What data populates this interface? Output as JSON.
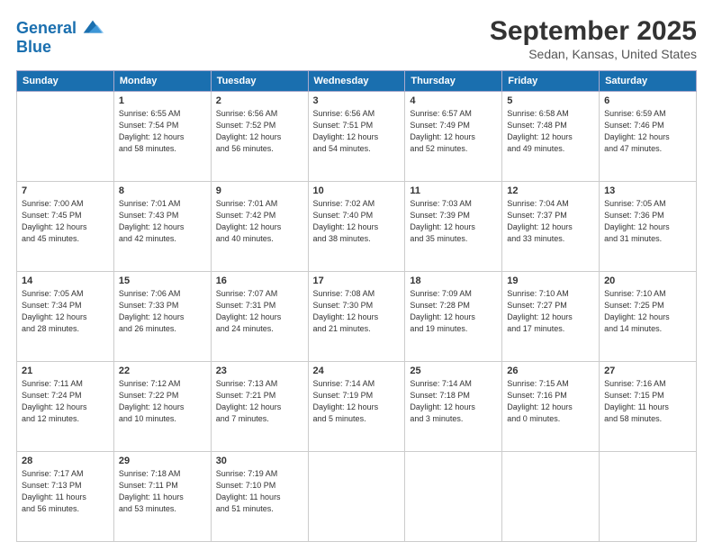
{
  "header": {
    "logo_line1": "General",
    "logo_line2": "Blue",
    "month_title": "September 2025",
    "location": "Sedan, Kansas, United States"
  },
  "weekdays": [
    "Sunday",
    "Monday",
    "Tuesday",
    "Wednesday",
    "Thursday",
    "Friday",
    "Saturday"
  ],
  "weeks": [
    [
      {
        "day": "",
        "info": ""
      },
      {
        "day": "1",
        "info": "Sunrise: 6:55 AM\nSunset: 7:54 PM\nDaylight: 12 hours\nand 58 minutes."
      },
      {
        "day": "2",
        "info": "Sunrise: 6:56 AM\nSunset: 7:52 PM\nDaylight: 12 hours\nand 56 minutes."
      },
      {
        "day": "3",
        "info": "Sunrise: 6:56 AM\nSunset: 7:51 PM\nDaylight: 12 hours\nand 54 minutes."
      },
      {
        "day": "4",
        "info": "Sunrise: 6:57 AM\nSunset: 7:49 PM\nDaylight: 12 hours\nand 52 minutes."
      },
      {
        "day": "5",
        "info": "Sunrise: 6:58 AM\nSunset: 7:48 PM\nDaylight: 12 hours\nand 49 minutes."
      },
      {
        "day": "6",
        "info": "Sunrise: 6:59 AM\nSunset: 7:46 PM\nDaylight: 12 hours\nand 47 minutes."
      }
    ],
    [
      {
        "day": "7",
        "info": "Sunrise: 7:00 AM\nSunset: 7:45 PM\nDaylight: 12 hours\nand 45 minutes."
      },
      {
        "day": "8",
        "info": "Sunrise: 7:01 AM\nSunset: 7:43 PM\nDaylight: 12 hours\nand 42 minutes."
      },
      {
        "day": "9",
        "info": "Sunrise: 7:01 AM\nSunset: 7:42 PM\nDaylight: 12 hours\nand 40 minutes."
      },
      {
        "day": "10",
        "info": "Sunrise: 7:02 AM\nSunset: 7:40 PM\nDaylight: 12 hours\nand 38 minutes."
      },
      {
        "day": "11",
        "info": "Sunrise: 7:03 AM\nSunset: 7:39 PM\nDaylight: 12 hours\nand 35 minutes."
      },
      {
        "day": "12",
        "info": "Sunrise: 7:04 AM\nSunset: 7:37 PM\nDaylight: 12 hours\nand 33 minutes."
      },
      {
        "day": "13",
        "info": "Sunrise: 7:05 AM\nSunset: 7:36 PM\nDaylight: 12 hours\nand 31 minutes."
      }
    ],
    [
      {
        "day": "14",
        "info": "Sunrise: 7:05 AM\nSunset: 7:34 PM\nDaylight: 12 hours\nand 28 minutes."
      },
      {
        "day": "15",
        "info": "Sunrise: 7:06 AM\nSunset: 7:33 PM\nDaylight: 12 hours\nand 26 minutes."
      },
      {
        "day": "16",
        "info": "Sunrise: 7:07 AM\nSunset: 7:31 PM\nDaylight: 12 hours\nand 24 minutes."
      },
      {
        "day": "17",
        "info": "Sunrise: 7:08 AM\nSunset: 7:30 PM\nDaylight: 12 hours\nand 21 minutes."
      },
      {
        "day": "18",
        "info": "Sunrise: 7:09 AM\nSunset: 7:28 PM\nDaylight: 12 hours\nand 19 minutes."
      },
      {
        "day": "19",
        "info": "Sunrise: 7:10 AM\nSunset: 7:27 PM\nDaylight: 12 hours\nand 17 minutes."
      },
      {
        "day": "20",
        "info": "Sunrise: 7:10 AM\nSunset: 7:25 PM\nDaylight: 12 hours\nand 14 minutes."
      }
    ],
    [
      {
        "day": "21",
        "info": "Sunrise: 7:11 AM\nSunset: 7:24 PM\nDaylight: 12 hours\nand 12 minutes."
      },
      {
        "day": "22",
        "info": "Sunrise: 7:12 AM\nSunset: 7:22 PM\nDaylight: 12 hours\nand 10 minutes."
      },
      {
        "day": "23",
        "info": "Sunrise: 7:13 AM\nSunset: 7:21 PM\nDaylight: 12 hours\nand 7 minutes."
      },
      {
        "day": "24",
        "info": "Sunrise: 7:14 AM\nSunset: 7:19 PM\nDaylight: 12 hours\nand 5 minutes."
      },
      {
        "day": "25",
        "info": "Sunrise: 7:14 AM\nSunset: 7:18 PM\nDaylight: 12 hours\nand 3 minutes."
      },
      {
        "day": "26",
        "info": "Sunrise: 7:15 AM\nSunset: 7:16 PM\nDaylight: 12 hours\nand 0 minutes."
      },
      {
        "day": "27",
        "info": "Sunrise: 7:16 AM\nSunset: 7:15 PM\nDaylight: 11 hours\nand 58 minutes."
      }
    ],
    [
      {
        "day": "28",
        "info": "Sunrise: 7:17 AM\nSunset: 7:13 PM\nDaylight: 11 hours\nand 56 minutes."
      },
      {
        "day": "29",
        "info": "Sunrise: 7:18 AM\nSunset: 7:11 PM\nDaylight: 11 hours\nand 53 minutes."
      },
      {
        "day": "30",
        "info": "Sunrise: 7:19 AM\nSunset: 7:10 PM\nDaylight: 11 hours\nand 51 minutes."
      },
      {
        "day": "",
        "info": ""
      },
      {
        "day": "",
        "info": ""
      },
      {
        "day": "",
        "info": ""
      },
      {
        "day": "",
        "info": ""
      }
    ]
  ]
}
